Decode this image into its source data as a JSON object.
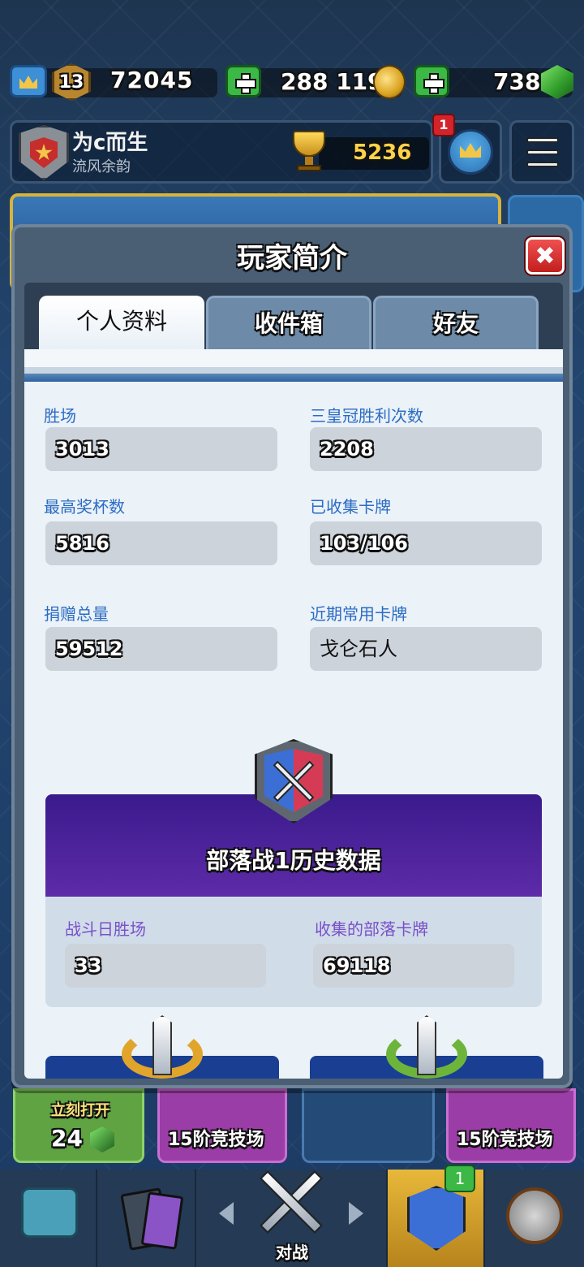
{
  "topbar": {
    "level": "13",
    "xp": "72045",
    "gold": "288 119",
    "gems": "738"
  },
  "player": {
    "name": "为c而生",
    "clan": "流风余韵",
    "trophies": "5236",
    "notification_count": "1"
  },
  "modal": {
    "title": "玩家简介",
    "close_label": "✖",
    "tabs": [
      {
        "label": "个人资料"
      },
      {
        "label": "收件箱"
      },
      {
        "label": "好友"
      }
    ],
    "stats": [
      {
        "label": "胜场",
        "value": "3013"
      },
      {
        "label": "三皇冠胜利次数",
        "value": "2208"
      },
      {
        "label": "最高奖杯数",
        "value": "5816"
      },
      {
        "label": "已收集卡牌",
        "value": "103/106"
      },
      {
        "label": "捐赠总量",
        "value": "59512"
      },
      {
        "label": "近期常用卡牌",
        "value": "戈仑石人"
      }
    ],
    "clan_war": {
      "title": "部落战1历史数据",
      "stats": [
        {
          "label": "战斗日胜场",
          "value": "33"
        },
        {
          "label": "收集的部落卡牌",
          "value": "69118"
        }
      ]
    }
  },
  "background": {
    "chest_open_label": "立刻打开",
    "chest_gem_cost": "24",
    "arena_label_1": "15阶竞技场",
    "arena_label_2": "15阶竞技场"
  },
  "nav": {
    "battle_label": "对战",
    "clan_badge": "1"
  },
  "colors": {
    "accent_blue": "#2b6cc4",
    "war_purple": "#5e2ba8",
    "close_red": "#d32f2f",
    "gold": "#ffd24a"
  }
}
